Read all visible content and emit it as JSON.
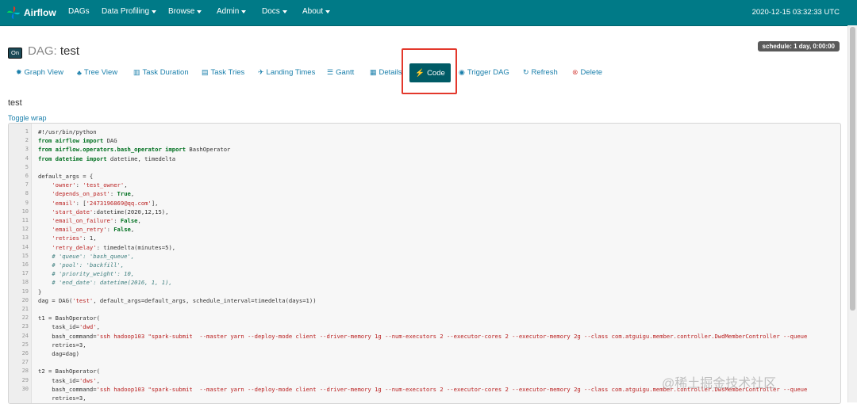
{
  "brand": "Airflow",
  "nav": [
    {
      "label": "DAGs",
      "dropdown": false
    },
    {
      "label": "Data Profiling",
      "dropdown": true
    },
    {
      "label": "Browse",
      "dropdown": true
    },
    {
      "label": "Admin",
      "dropdown": true
    },
    {
      "label": "Docs",
      "dropdown": true
    },
    {
      "label": "About",
      "dropdown": true
    }
  ],
  "clock": "2020-12-15 03:32:33 UTC",
  "dag": {
    "toggle": "On",
    "prefix": "DAG:",
    "name": "test",
    "schedule": "schedule: 1 day, 0:00:00"
  },
  "tabs": [
    {
      "label": "Graph View",
      "icon": "✹"
    },
    {
      "label": "Tree View",
      "icon": "♣"
    },
    {
      "label": "Task Duration",
      "icon": "▥"
    },
    {
      "label": "Task Tries",
      "icon": "▤"
    },
    {
      "label": "Landing Times",
      "icon": "✈"
    },
    {
      "label": "Gantt",
      "icon": "☰"
    },
    {
      "label": "Details",
      "icon": "▦"
    },
    {
      "label": "Code",
      "icon": "⚡"
    },
    {
      "label": "Trigger DAG",
      "icon": "◉"
    },
    {
      "label": "Refresh",
      "icon": "↻"
    },
    {
      "label": "Delete",
      "icon": "⊗"
    }
  ],
  "file_title": "test",
  "toggle_wrap": "Toggle wrap",
  "line_numbers": [
    "1",
    "2",
    "3",
    "4",
    "5",
    "6",
    "7",
    "8",
    "9",
    "10",
    "11",
    "12",
    "13",
    "14",
    "15",
    "16",
    "17",
    "18",
    "19",
    "20",
    "21",
    "22",
    "23",
    "24",
    "25",
    "26",
    "27",
    "28",
    "29",
    "30"
  ],
  "code_lines": [
    [
      [
        "#!/usr/bin/python",
        "t"
      ]
    ],
    [
      [
        "from ",
        "k"
      ],
      [
        "airflow ",
        "k"
      ],
      [
        "import ",
        "k"
      ],
      [
        "DAG",
        "t"
      ]
    ],
    [
      [
        "from ",
        "k"
      ],
      [
        "airflow.operators.bash_operator ",
        "k"
      ],
      [
        "import ",
        "k"
      ],
      [
        "BashOperator",
        "t"
      ]
    ],
    [
      [
        "from ",
        "k"
      ],
      [
        "datetime ",
        "k"
      ],
      [
        "import ",
        "k"
      ],
      [
        "datetime, timedelta",
        "t"
      ]
    ],
    [],
    [
      [
        "default_args = {",
        "t"
      ]
    ],
    [
      [
        "    ",
        "t"
      ],
      [
        "'owner'",
        "s"
      ],
      [
        ": ",
        "t"
      ],
      [
        "'test_owner'",
        "s"
      ],
      [
        ",",
        "t"
      ]
    ],
    [
      [
        "    ",
        "t"
      ],
      [
        "'depends_on_past'",
        "s"
      ],
      [
        ": ",
        "t"
      ],
      [
        "True",
        "k"
      ],
      [
        ",",
        "t"
      ]
    ],
    [
      [
        "    ",
        "t"
      ],
      [
        "'email'",
        "s"
      ],
      [
        ": [",
        "t"
      ],
      [
        "'2473196869@qq.com'",
        "s"
      ],
      [
        "],",
        "t"
      ]
    ],
    [
      [
        "    ",
        "t"
      ],
      [
        "'start_date'",
        "s"
      ],
      [
        ":datetime(2020,12,15),",
        "t"
      ]
    ],
    [
      [
        "    ",
        "t"
      ],
      [
        "'email_on_failure'",
        "s"
      ],
      [
        ": ",
        "t"
      ],
      [
        "False",
        "k"
      ],
      [
        ",",
        "t"
      ]
    ],
    [
      [
        "    ",
        "t"
      ],
      [
        "'email_on_retry'",
        "s"
      ],
      [
        ": ",
        "t"
      ],
      [
        "False",
        "k"
      ],
      [
        ",",
        "t"
      ]
    ],
    [
      [
        "    ",
        "t"
      ],
      [
        "'retries'",
        "s"
      ],
      [
        ": 1,",
        "t"
      ]
    ],
    [
      [
        "    ",
        "t"
      ],
      [
        "'retry_delay'",
        "s"
      ],
      [
        ": timedelta(minutes=5),",
        "t"
      ]
    ],
    [
      [
        "    ",
        "t"
      ],
      [
        "# 'queue': 'bash_queue',",
        "c"
      ]
    ],
    [
      [
        "    ",
        "t"
      ],
      [
        "# 'pool': 'backfill',",
        "c"
      ]
    ],
    [
      [
        "    ",
        "t"
      ],
      [
        "# 'priority_weight': 10,",
        "c"
      ]
    ],
    [
      [
        "    ",
        "t"
      ],
      [
        "# 'end_date': datetime(2016, 1, 1),",
        "c"
      ]
    ],
    [
      [
        "}",
        "t"
      ]
    ],
    [
      [
        "dag = DAG(",
        "t"
      ],
      [
        "'test'",
        "s"
      ],
      [
        ", default_args=default_args, schedule_interval=timedelta(days=1))",
        "t"
      ]
    ],
    [],
    [
      [
        "t1 = BashOperator(",
        "t"
      ]
    ],
    [
      [
        "    task_id=",
        "t"
      ],
      [
        "'dwd'",
        "s"
      ],
      [
        ",",
        "t"
      ]
    ],
    [
      [
        "    bash_command=",
        "t"
      ],
      [
        "'ssh hadoop103 \"spark-submit  --master yarn --deploy-mode client --driver-memory 1g --num-executors 2 --executor-cores 2 --executor-memory 2g --class com.atguigu.member.controller.DwdMemberController --queue",
        "s"
      ]
    ],
    [
      [
        "    retries=3,",
        "t"
      ]
    ],
    [
      [
        "    dag=dag)",
        "t"
      ]
    ],
    [],
    [
      [
        "t2 = BashOperator(",
        "t"
      ]
    ],
    [
      [
        "    task_id=",
        "t"
      ],
      [
        "'dws'",
        "s"
      ],
      [
        ",",
        "t"
      ]
    ],
    [
      [
        "    bash_command=",
        "t"
      ],
      [
        "'ssh hadoop103 \"spark-submit  --master yarn --deploy-mode client --driver-memory 1g --num-executors 2 --executor-cores 2 --executor-memory 2g --class com.atguigu.member.controller.DwsMemberController --queue",
        "s"
      ]
    ],
    [
      [
        "    retries=3,",
        "t"
      ]
    ]
  ],
  "watermark": "@稀土掘金技术社区",
  "colors": {
    "navbar": "#007a87",
    "active_tab": "#005b66",
    "link": "#1a7fab",
    "highlight_box": "#e3382c"
  }
}
